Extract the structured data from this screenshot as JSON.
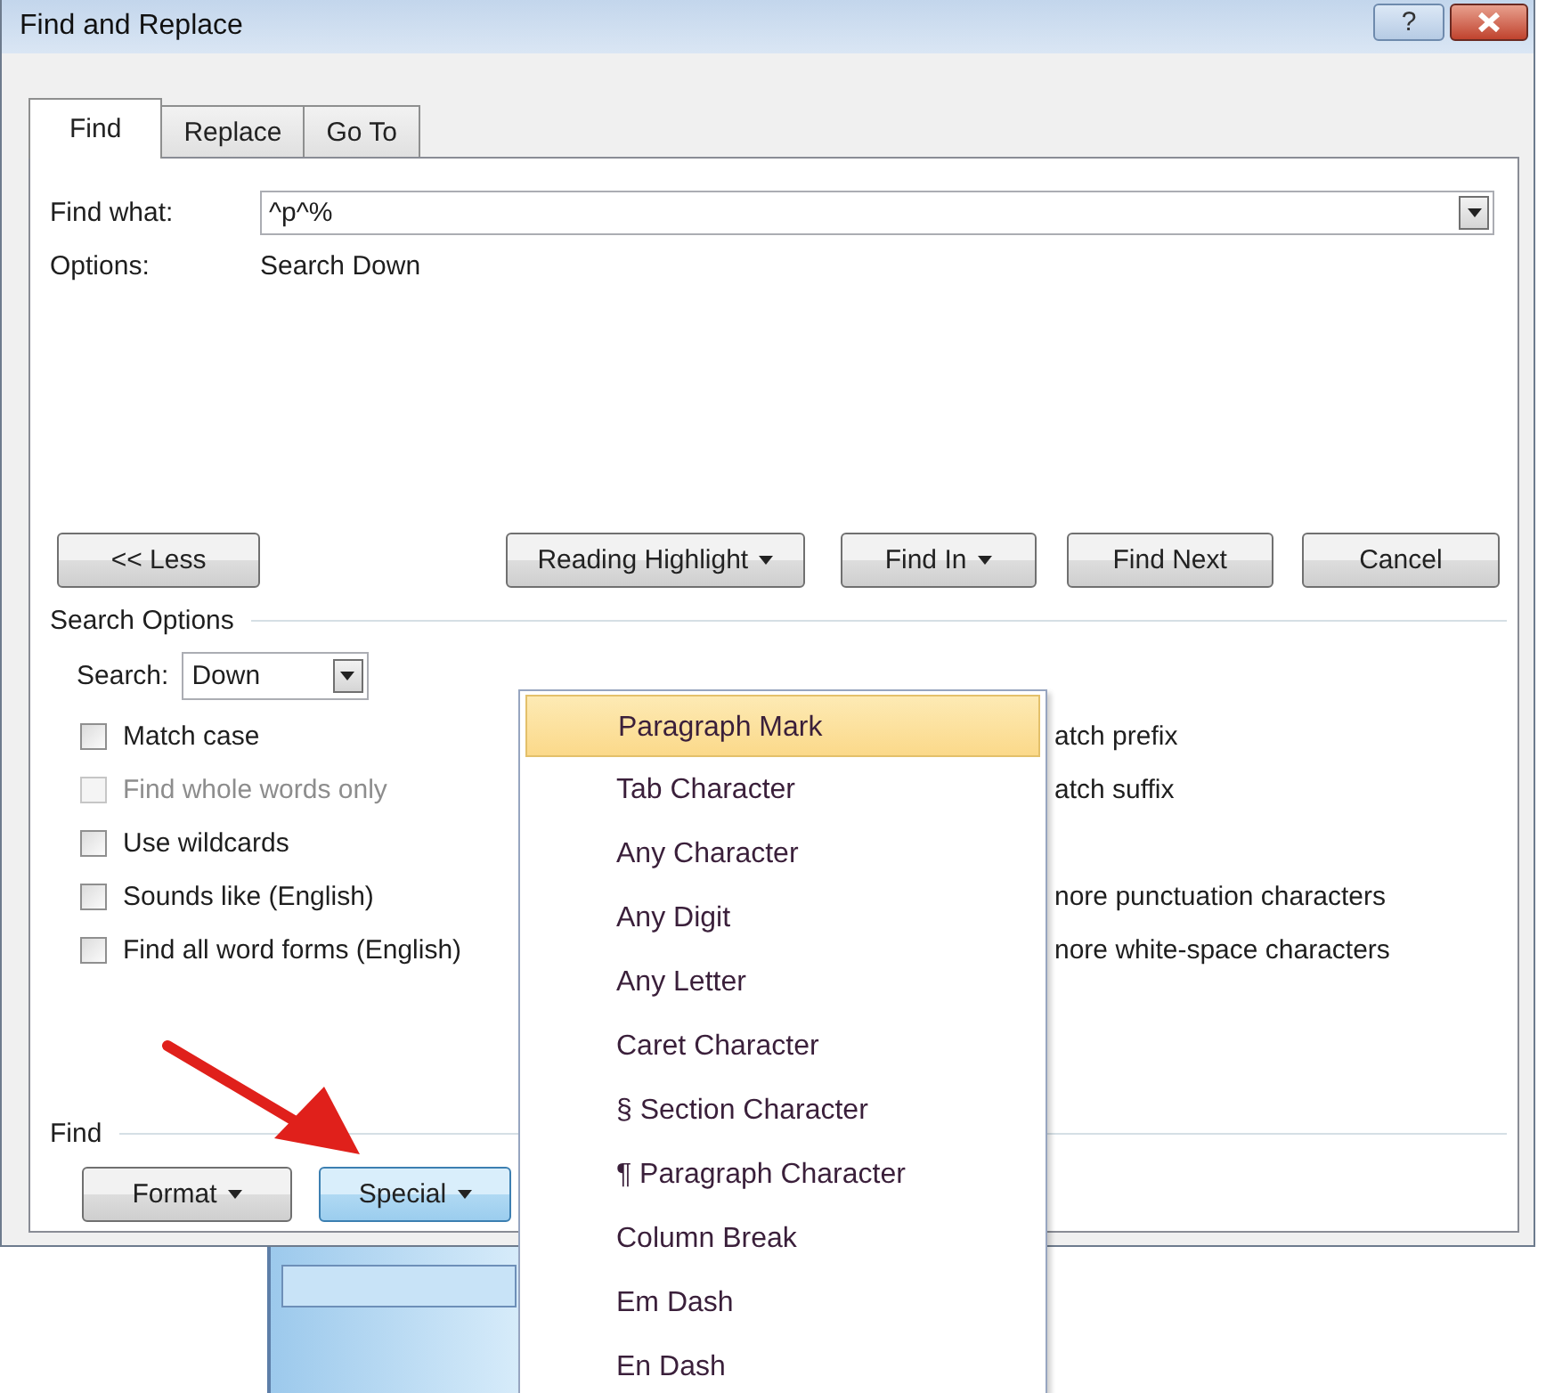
{
  "window": {
    "title": "Find and Replace",
    "help_label": "?"
  },
  "tabs": [
    {
      "label": "Find",
      "selected": true
    },
    {
      "label": "Replace",
      "selected": false
    },
    {
      "label": "Go To",
      "selected": false
    }
  ],
  "find_what": {
    "label": "Find what:",
    "value": "^p^%"
  },
  "options": {
    "label": "Options:",
    "value": "Search Down"
  },
  "buttons": [
    {
      "label": "<< Less",
      "dropdown": false
    },
    {
      "label": "Reading Highlight",
      "dropdown": true
    },
    {
      "label": "Find In",
      "dropdown": true
    },
    {
      "label": "Find Next",
      "dropdown": false
    },
    {
      "label": "Cancel",
      "dropdown": false
    }
  ],
  "search_options": {
    "title": "Search Options",
    "search_label": "Search:",
    "search_value": "Down",
    "checkboxes": [
      {
        "label": "Match case",
        "checked": false,
        "disabled": false
      },
      {
        "label": "Find whole words only",
        "checked": false,
        "disabled": true
      },
      {
        "label": "Use wildcards",
        "checked": false,
        "disabled": false
      },
      {
        "label": "Sounds like (English)",
        "checked": false,
        "disabled": false
      },
      {
        "label": "Find all word forms (English)",
        "checked": false,
        "disabled": false
      }
    ],
    "right_top": [
      "atch prefix",
      "atch suffix"
    ],
    "right_bottom": [
      "nore punctuation characters",
      "nore white-space characters"
    ]
  },
  "find_section": {
    "title": "Find",
    "buttons": [
      {
        "label": "Format",
        "pressed": false
      },
      {
        "label": "Special",
        "pressed": true
      }
    ]
  },
  "special_menu": [
    {
      "label": "Paragraph Mark",
      "selected": true
    },
    {
      "label": "Tab Character",
      "selected": false
    },
    {
      "label": "Any Character",
      "selected": false
    },
    {
      "label": "Any Digit",
      "selected": false
    },
    {
      "label": "Any Letter",
      "selected": false
    },
    {
      "label": "Caret Character",
      "selected": false
    },
    {
      "label": "§ Section Character",
      "selected": false
    },
    {
      "label": "¶ Paragraph Character",
      "selected": false
    },
    {
      "label": "Column Break",
      "selected": false
    },
    {
      "label": "Em Dash",
      "selected": false
    },
    {
      "label": "En Dash",
      "selected": false
    }
  ]
}
